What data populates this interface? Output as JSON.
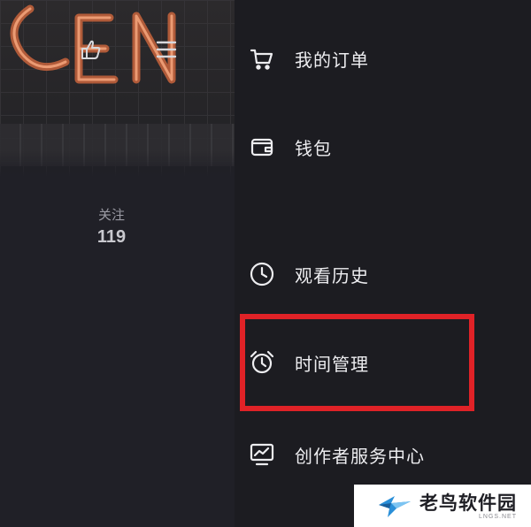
{
  "profile": {
    "follow_label": "关注",
    "follow_count": "119",
    "icons": [
      "share-hand-icon",
      "hamburger-menu-icon"
    ]
  },
  "menu": {
    "items": [
      {
        "label": "我的订单",
        "icon": "cart-icon"
      },
      {
        "label": "钱包",
        "icon": "wallet-icon"
      },
      {
        "label": "观看历史",
        "icon": "clock-icon"
      },
      {
        "label": "时间管理",
        "icon": "alarm-clock-icon"
      },
      {
        "label": "创作者服务中心",
        "icon": "monitor-chart-icon"
      }
    ],
    "highlighted": "时间管理"
  },
  "watermark": {
    "title": "老鸟软件园",
    "subtitle": "LNGS.NET"
  },
  "colors": {
    "background": "#1c1c21",
    "text": "#ededf0",
    "highlight": "#e02227"
  }
}
